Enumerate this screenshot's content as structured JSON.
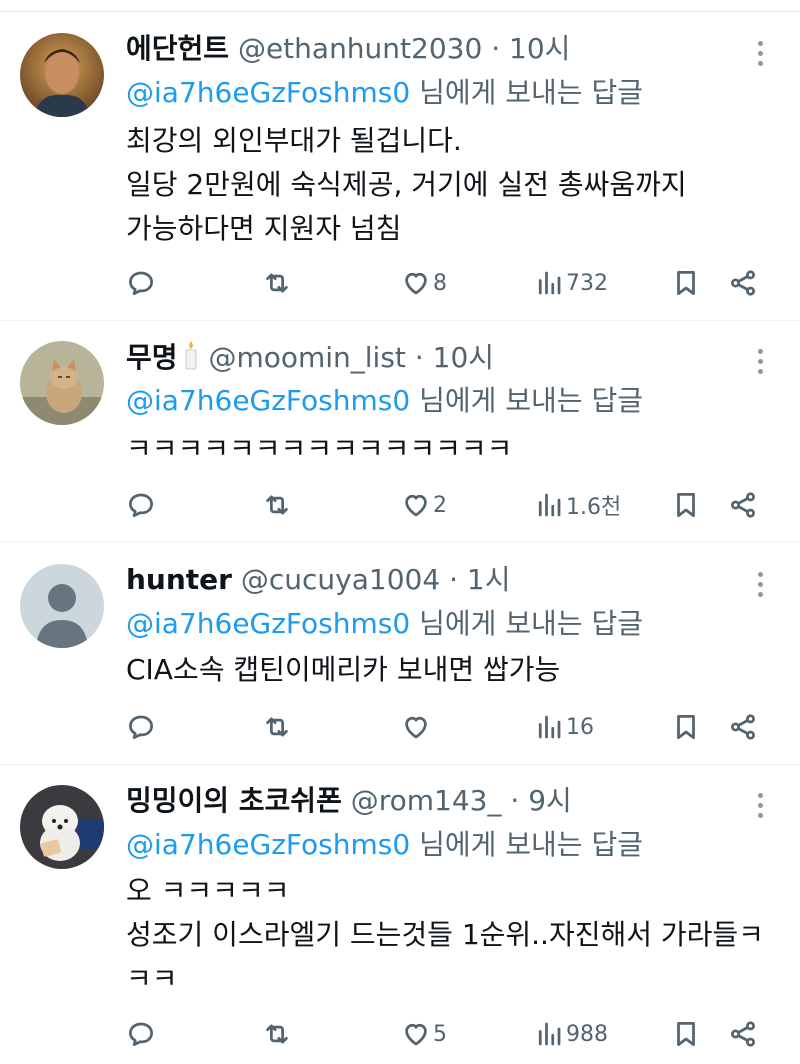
{
  "reply_prefix_suffix": "님에게 보내는 답글",
  "tweets": [
    {
      "name": "에단헌트",
      "handle": "@ethanhunt2030",
      "dot": "·",
      "time": "10시",
      "reply_to": "@ia7h6eGzFoshms0",
      "lines": [
        "최강의 외인부대가 될겁니다.",
        "일당 2만원에 숙식제공, 거기에 실전 총싸움까지",
        "가능하다면 지원자 넘침"
      ],
      "likes": "8",
      "views": "732",
      "avatar_icon": "profile-photo-man"
    },
    {
      "name": "무명",
      "name_emoji": "candle-emoji",
      "handle": "@moomin_list",
      "dot": "·",
      "time": "10시",
      "reply_to": "@ia7h6eGzFoshms0",
      "lines": [
        "ㅋㅋㅋㅋㅋㅋㅋㅋㅋㅋㅋㅋㅋㅋㅋ"
      ],
      "likes": "2",
      "views": "1.6천",
      "avatar_icon": "profile-photo-cat"
    },
    {
      "name": "hunter",
      "handle": "@cucuya1004",
      "dot": "·",
      "time": "1시",
      "reply_to": "@ia7h6eGzFoshms0",
      "lines": [
        "CIA소속 캡틴이메리카 보내면 쌉가능"
      ],
      "likes": "",
      "views": "16",
      "avatar_icon": "default-avatar"
    },
    {
      "name": "밍밍이의 초코쉬폰",
      "handle": "@rom143_",
      "dot": "·",
      "time": "9시",
      "reply_to": "@ia7h6eGzFoshms0",
      "lines": [
        "오 ㅋㅋㅋㅋㅋ",
        "성조기 이스라엘기 드는것들 1순위..자진해서 가라들ㅋ",
        "ㅋㅋ"
      ],
      "likes": "5",
      "views": "988",
      "avatar_icon": "profile-photo-dog"
    }
  ],
  "colors": {
    "link": "#1d9bf0",
    "secondary_text": "#536471",
    "primary_text": "#0f1419",
    "divider": "#eff3f4"
  }
}
